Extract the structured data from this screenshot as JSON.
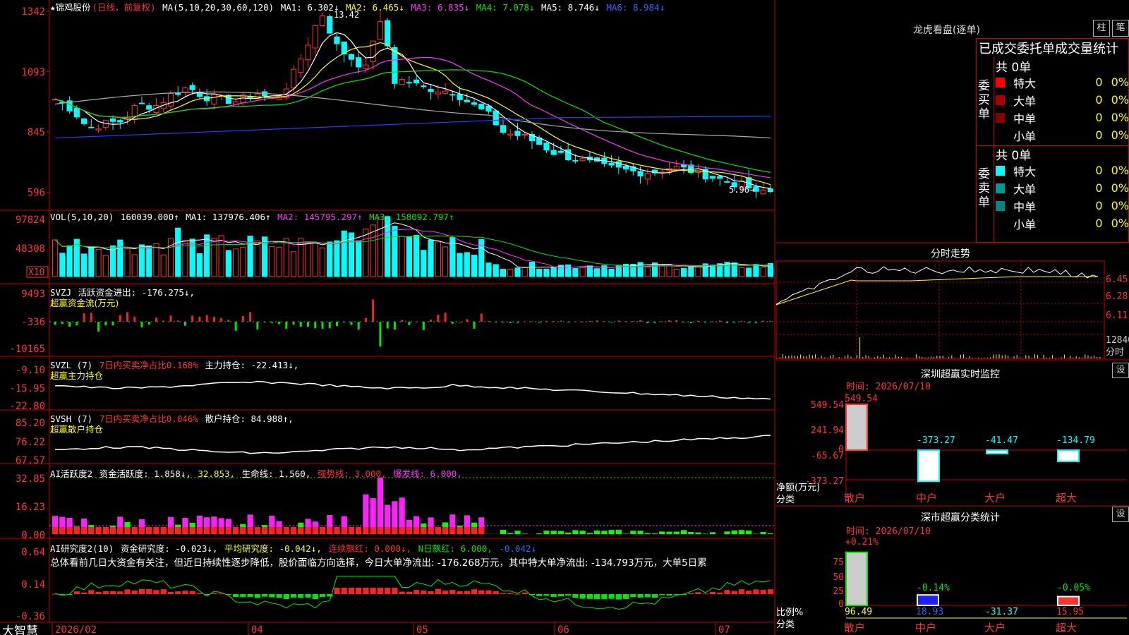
{
  "colors": {
    "up": "#ff3232",
    "down": "#00ffff",
    "ma1": "#ffffff",
    "ma2": "#ffff00",
    "ma3": "#ff32ff",
    "ma4": "#00e600",
    "ma5": "#aaaaaa",
    "ma6": "#2040ff",
    "grid": "#cc0000"
  },
  "main": {
    "stock": "★锦鸡股份",
    "mode": "(日线，前复权)",
    "ma_spec": "MA(5,10,20,30,60,120)",
    "ma1": "MA1: 6.302↓",
    "ma2": "MA2: 6.465↓",
    "ma3": "MA3: 6.835↓",
    "ma4": "MA4: 7.078↓",
    "ma5": "MA5: 8.746↓",
    "ma6": "MA6: 8.984↓",
    "y_ticks": [
      "1342",
      "1093",
      "845",
      "596"
    ],
    "high_label": "13.42",
    "low_label": "5.96→"
  },
  "vol": {
    "title": "VOL(5,10,20)",
    "value": "160039.000↑",
    "ma1": "MA1: 137976.406↑",
    "ma2": "MA2: 145795.297↑",
    "ma3": "MA3: 158092.797↑",
    "y_ticks": [
      "97824",
      "48308"
    ],
    "unit": "X10"
  },
  "svzj": {
    "title": "SVZJ",
    "line": "活跃资金进出: -176.275↓,",
    "sub": "超赢资金流(万元)",
    "y_ticks": [
      "9493",
      "-336",
      "-10165"
    ]
  },
  "svzl": {
    "title": "SVZL (7)",
    "pct": "7日内买卖净占比0.168%",
    "line": "主力持仓: -22.413↓,",
    "sub": "超赢主力持仓",
    "y_ticks": [
      "-9.10",
      "-15.95",
      "-22.80"
    ]
  },
  "svsh": {
    "title": "SVSH (7)",
    "pct": "7日内买卖净占比0.046%",
    "line": "散户持仓: 84.988↑,",
    "sub": "超赢散户持仓",
    "y_ticks": [
      "85.20",
      "76.22",
      "67.57"
    ]
  },
  "ai1": {
    "title": "AI活跃度2",
    "l1": "资金活跃度: 1.858↓,",
    "l2": "32.853,",
    "l3": "生命线: 1.560,",
    "l4": "强势线: 3.000,",
    "l5": "爆发线: 6.000,",
    "y_ticks": [
      "32.85",
      "16.23",
      "0.00"
    ]
  },
  "ai2": {
    "title": "AI研究度2(10)",
    "l1": "资金研究度: -0.023↓,",
    "l2": "平均研究度: -0.042↓,",
    "l3": "连续飘红: 0.000↓,",
    "l4": "N日飘红: 6.000,",
    "l5": "-0.042↓",
    "comment": "总体看前几日大资金有关注，但近日持续性逐步降低，股价面临方向选择，今日大单净流出: -176.268万元，其中特大单净流出: -134.793万元，大单5日累",
    "y_ticks": [
      "0.64",
      "0.14",
      "-0.36"
    ]
  },
  "xaxis": {
    "brand": "大智慧",
    "labels": [
      "2026/02",
      "04",
      "05",
      "06",
      "07"
    ]
  },
  "right": {
    "title": "龙虎看盘(逐单)",
    "btn1": "柱",
    "btn2": "笔",
    "table_title": "已成交委托单成交量统计",
    "buy_label": "委买单",
    "sell_label": "委卖单",
    "buy_total": "共 0单",
    "sell_total": "共 0单",
    "buy_rows": [
      {
        "name": "特大",
        "v": "0",
        "p": "0%"
      },
      {
        "name": "大单",
        "v": "0",
        "p": "0%"
      },
      {
        "name": "中单",
        "v": "0",
        "p": "0%"
      },
      {
        "name": "小单",
        "v": "0",
        "p": "0%"
      }
    ],
    "sell_rows": [
      {
        "name": "特大",
        "v": "0",
        "p": "0%"
      },
      {
        "name": "大单",
        "v": "0",
        "p": "0%"
      },
      {
        "name": "中单",
        "v": "0",
        "p": "0%"
      },
      {
        "name": "小单",
        "v": "0",
        "p": "0%"
      }
    ],
    "intraday_title": "分时走势",
    "intraday_ticks": [
      "6.45",
      "6.28",
      "6.11",
      "12840",
      "分时"
    ],
    "mon_title": "深圳超赢实时监控",
    "mon_btn": "设",
    "mon_time": "时间: 2026/07/10",
    "mon_y": [
      "549.54",
      "241.94",
      "0",
      "-65.67",
      "-373.27"
    ],
    "mon_ylabel": "净额(万元)",
    "mon_xlabel": "分类",
    "mon_bars": [
      {
        "label": "549.54",
        "cat": "散户",
        "v": 549.54
      },
      {
        "label": "-373.27",
        "cat": "中户",
        "v": -373.27
      },
      {
        "label": "-41.47",
        "cat": "大户",
        "v": -41.47
      },
      {
        "label": "-134.79",
        "cat": "超大",
        "v": -134.79
      }
    ],
    "cls_title": "深市超赢分类统计",
    "cls_btn": "设",
    "cls_time": "时间: 2026/07/10",
    "cls_y": [
      "75",
      "50",
      "25",
      "0"
    ],
    "cls_ylabel": "比例%",
    "cls_xlabel": "分类",
    "cls_bars": [
      {
        "top": "+0.21%",
        "bottom": "96.49",
        "cat": "散户",
        "v": 96.49
      },
      {
        "top": "-0.14%",
        "bottom": "18.93",
        "cat": "中户",
        "v": 18.93
      },
      {
        "top": "",
        "bottom": "-31.37",
        "cat": "大户",
        "v": 0
      },
      {
        "top": "-0.05%",
        "bottom": "15.95",
        "cat": "超大",
        "v": 15.95
      }
    ]
  },
  "chart_data": {
    "type": "candlestick",
    "title": "锦鸡股份 日线 前复权",
    "close_approx": [
      9.8,
      9.4,
      8.6,
      8.8,
      8.9,
      9.6,
      9.5,
      10.0,
      10.3,
      9.9,
      9.8,
      9.7,
      10.1,
      9.8,
      10.4,
      11.8,
      13.4,
      11.9,
      11.4,
      10.9,
      10.5,
      10.6,
      10.3,
      10.2,
      10.1,
      9.6,
      9.2,
      8.4,
      8.3,
      8.0,
      7.6,
      7.4,
      7.2,
      7.0,
      6.9,
      6.8,
      6.8,
      7.0,
      6.9,
      6.7,
      6.5,
      6.3,
      6.1,
      6.0
    ],
    "high": 13.42,
    "low": 5.96
  }
}
